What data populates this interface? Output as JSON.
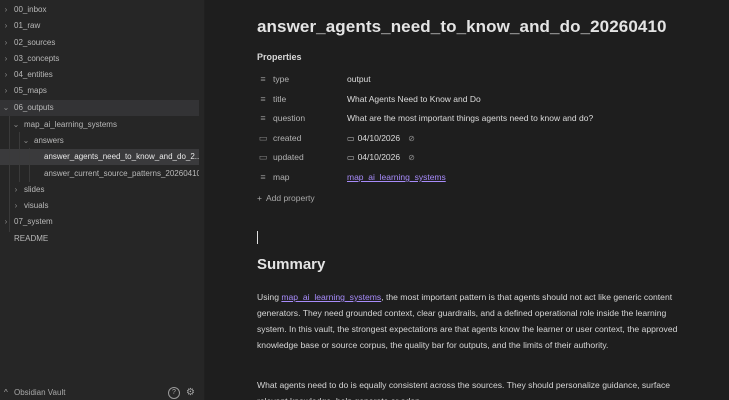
{
  "sidebar": {
    "items": [
      {
        "label": "00_inbox",
        "chevron": "›"
      },
      {
        "label": "01_raw",
        "chevron": "›"
      },
      {
        "label": "02_sources",
        "chevron": "›"
      },
      {
        "label": "03_concepts",
        "chevron": "›"
      },
      {
        "label": "04_entities",
        "chevron": "›"
      },
      {
        "label": "05_maps",
        "chevron": "›"
      },
      {
        "label": "06_outputs",
        "chevron": "⌄"
      },
      {
        "label": "map_ai_learning_systems",
        "chevron": "⌄"
      },
      {
        "label": "answers",
        "chevron": "⌄"
      },
      {
        "label": "answer_agents_need_to_know_and_do_2...",
        "chevron": ""
      },
      {
        "label": "answer_current_source_patterns_20260410",
        "chevron": ""
      },
      {
        "label": "slides",
        "chevron": "›"
      },
      {
        "label": "visuals",
        "chevron": "›"
      },
      {
        "label": "07_system",
        "chevron": "›"
      },
      {
        "label": "README",
        "chevron": ""
      }
    ],
    "vault_name": "Obsidian Vault",
    "vault_caret": "^",
    "help_glyph": "?",
    "gear_glyph": "⚙"
  },
  "note": {
    "title": "answer_agents_need_to_know_and_do_20260410",
    "properties_heading": "Properties",
    "properties": [
      {
        "icon": "list-icon",
        "glyph": "≡",
        "key": "type",
        "value": "output"
      },
      {
        "icon": "list-icon",
        "glyph": "≡",
        "key": "title",
        "value": "What Agents Need to Know and Do"
      },
      {
        "icon": "list-icon",
        "glyph": "≡",
        "key": "question",
        "value": "What are the most important things agents need to know and do?"
      },
      {
        "icon": "calendar-icon",
        "glyph": "▭",
        "key": "created",
        "value": "04/10/2026"
      },
      {
        "icon": "calendar-icon",
        "glyph": "▭",
        "key": "updated",
        "value": "04/10/2026"
      },
      {
        "icon": "list-icon",
        "glyph": "≡",
        "key": "map",
        "value": "map_ai_learning_systems"
      }
    ],
    "add_property_label": "Add property",
    "add_property_glyph": "+",
    "date_glyph": "▭",
    "link_glyph": "⊘",
    "summary_heading": "Summary",
    "para1_prefix": "Using ",
    "para1_link": "map_ai_learning_systems",
    "para1_rest": ", the most important pattern is that agents should not act like generic content generators. They need grounded context, clear guardrails, and a defined operational role inside the learning system. In this vault, the strongest expectations are that agents know the learner or user context, the approved knowledge base or source corpus, the quality bar for outputs, and the limits of their authority.",
    "para2": "What agents need to do is equally consistent across the sources. They should personalize guidance, surface relevant knowledge, help generate or adap..."
  }
}
